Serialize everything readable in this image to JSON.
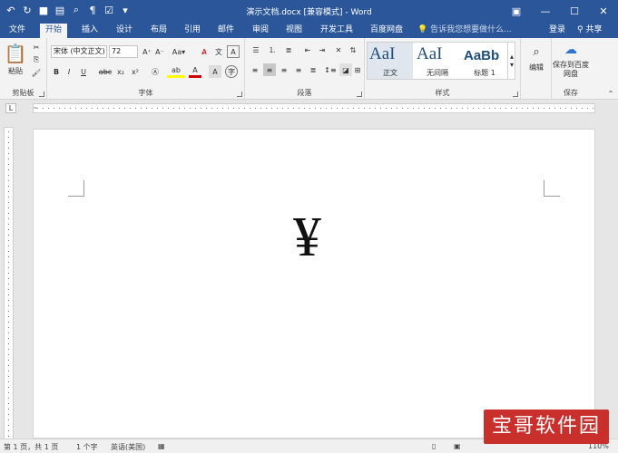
{
  "window": {
    "title": "演示文档.docx [兼容模式] - Word"
  },
  "tabs": [
    "文件",
    "开始",
    "插入",
    "设计",
    "布局",
    "引用",
    "邮件",
    "审阅",
    "视图",
    "开发工具",
    "百度网盘"
  ],
  "active_tab": "开始",
  "tell_me": "告诉我您想要做什么...",
  "account": {
    "login": "登录",
    "share": "共享"
  },
  "ribbon": {
    "clipboard": {
      "label": "剪贴板",
      "paste": "粘贴"
    },
    "font": {
      "label": "字体",
      "font_name": "宋体 (中文正文)",
      "font_size": "72",
      "bold": "B",
      "italic": "I",
      "underline": "U",
      "strike": "abc",
      "sub": "x₂",
      "sup": "x²"
    },
    "paragraph": {
      "label": "段落"
    },
    "styles": {
      "label": "样式",
      "items": [
        {
          "sample": "AaI",
          "name": "正文"
        },
        {
          "sample": "AaI",
          "name": "无间隔"
        },
        {
          "sample": "AaBb",
          "name": "标题 1"
        }
      ]
    },
    "editing": {
      "label": "编辑"
    },
    "save": {
      "label": "保存",
      "button": "保存到百度网盘"
    }
  },
  "document": {
    "content": "¥"
  },
  "status": {
    "page": "第 1 页，共 1 页",
    "words": "1 个字",
    "language": "英语(美国)",
    "zoom": "110%"
  },
  "watermark": "宝哥软件园"
}
